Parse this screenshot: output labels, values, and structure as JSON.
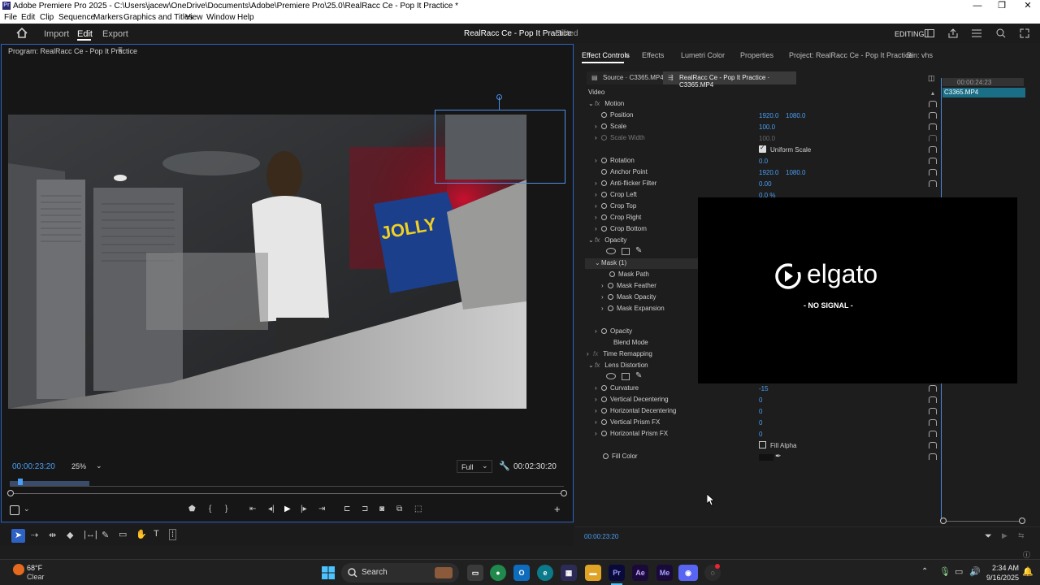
{
  "window": {
    "app_icon": "Pr",
    "title": "Adobe Premiere Pro 2025 - C:\\Users\\jacew\\OneDrive\\Documents\\Adobe\\Premiere Pro\\25.0\\RealRacc Ce - Pop It Practice *",
    "minimize": "—",
    "maximize": "❐",
    "close": "✕"
  },
  "menu": [
    "File",
    "Edit",
    "Clip",
    "Sequence",
    "Markers",
    "Graphics and Titles",
    "View",
    "Window",
    "Help"
  ],
  "workspace": {
    "tabs": [
      "Import",
      "Edit",
      "Export"
    ],
    "active": "Edit",
    "project_title": "RealRacc Ce - Pop It Practice",
    "edited_label": " - Edited",
    "mode_label": "EDITING"
  },
  "program": {
    "title": "Program: RealRacc Ce - Pop It Practice",
    "timecode": "00:00:23:20",
    "zoom": "25%",
    "quality": "Full",
    "duration": "00:02:30:20"
  },
  "panel_tabs": [
    "Effect Controls",
    "Effects",
    "Lumetri Color",
    "Properties",
    "Project: RealRacc Ce - Pop It Practice",
    "Bin: vhs"
  ],
  "effect_controls": {
    "source_tab": "Source · C3365.MP4",
    "seq_tab": "RealRacc Ce - Pop It Practice · C3365.MP4",
    "timeline_time": "00:00:24:23",
    "clip_name": "C3365.MP4",
    "section_video": "Video",
    "footer_time": "00:00:23:20",
    "rows": {
      "motion": "Motion",
      "position": "Position",
      "position_x": "1920.0",
      "position_y": "1080.0",
      "scale": "Scale",
      "scale_val": "100.0",
      "scale_width": "Scale Width",
      "scale_width_val": "100.0",
      "uniform_scale": "Uniform Scale",
      "rotation": "Rotation",
      "rotation_val": "0.0",
      "anchor": "Anchor Point",
      "anchor_x": "1920.0",
      "anchor_y": "1080.0",
      "antiflicker": "Anti-flicker Filter",
      "antiflicker_val": "0.00",
      "crop_left": "Crop Left",
      "crop_left_val": "0.0 %",
      "crop_top": "Crop Top",
      "crop_right": "Crop Right",
      "crop_bottom": "Crop Bottom",
      "opacity": "Opacity",
      "mask": "Mask (1)",
      "mask_path": "Mask Path",
      "mask_feather": "Mask Feather",
      "mask_opacity": "Mask Opacity",
      "mask_expansion": "Mask Expansion",
      "opacity_prop": "Opacity",
      "blend_mode": "Blend Mode",
      "time_remap": "Time Remapping",
      "lens": "Lens Distortion",
      "curvature": "Curvature",
      "curvature_val": "-15",
      "vdecent": "Vertical Decentering",
      "vdecent_val": "0",
      "hdecent": "Horizontal Decentering",
      "hdecent_val": "0",
      "vprism": "Vertical Prism FX",
      "vprism_val": "0",
      "hprism": "Horizontal Prism FX",
      "hprism_val": "0",
      "fill_alpha": "Fill Alpha",
      "fill_color": "Fill Color"
    }
  },
  "overlay": {
    "brand": "elgato",
    "status": "- NO SIGNAL -"
  },
  "taskbar": {
    "weather_temp": "68°F",
    "weather_desc": "Clear",
    "search": "Search",
    "time": "2:34 AM",
    "date": "9/16/2025"
  },
  "colors": {
    "accent": "#2d62c4",
    "value_blue": "#4a9ff5",
    "panel_bg": "#1d1d1d"
  }
}
